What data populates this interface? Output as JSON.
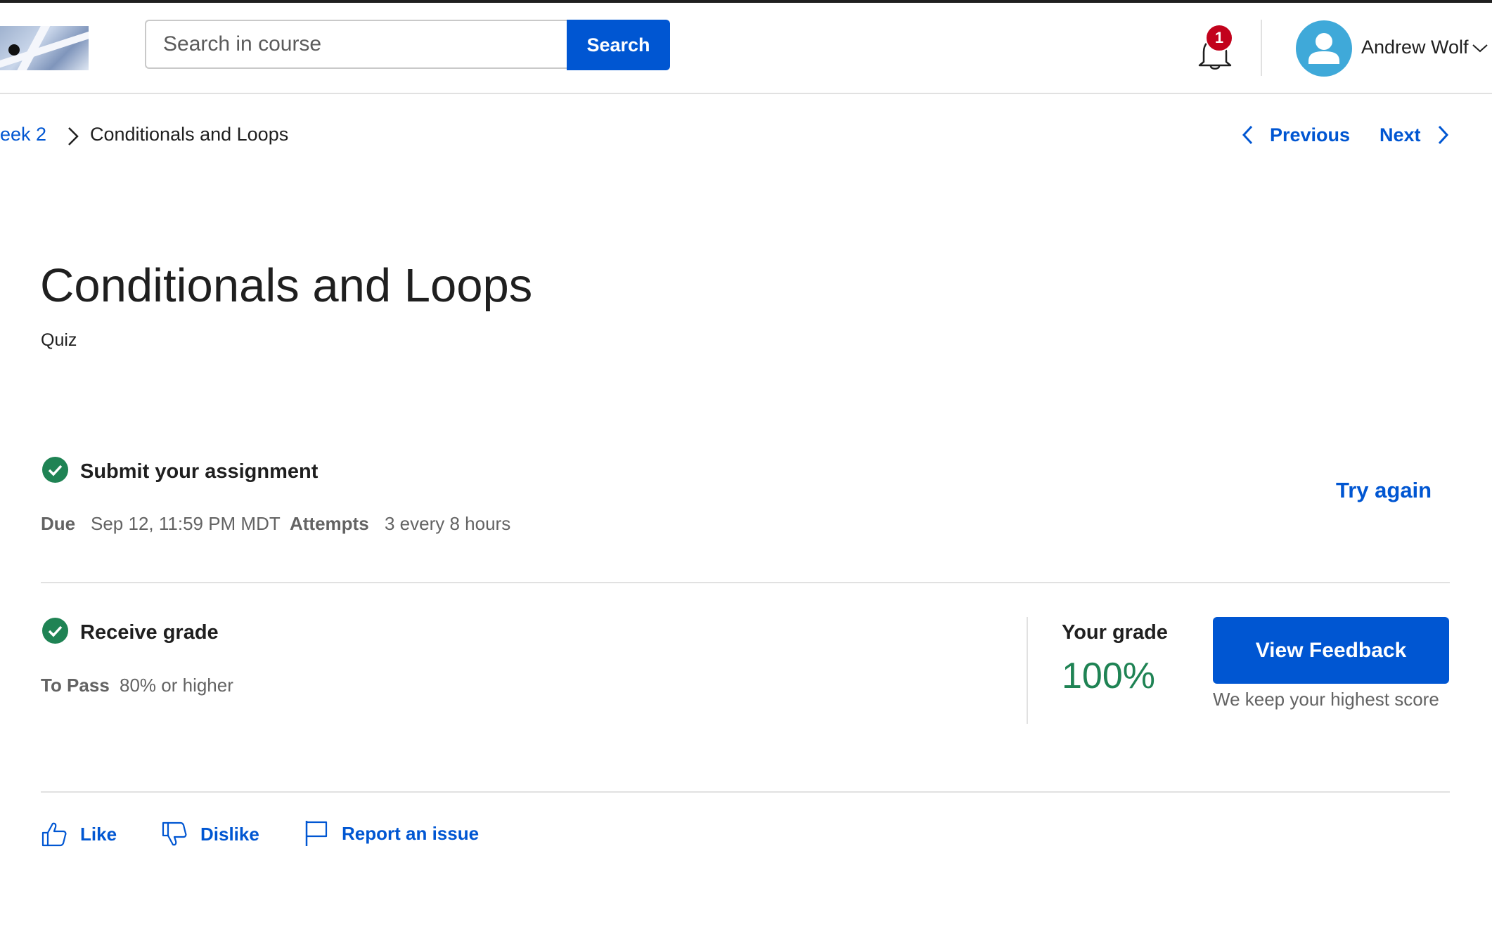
{
  "header": {
    "search_placeholder": "Search in course",
    "search_button": "Search",
    "notification_count": "1",
    "user_name": "Andrew Wolf"
  },
  "breadcrumb": {
    "parent": "eek 2",
    "current": "Conditionals and Loops"
  },
  "nav": {
    "previous": "Previous",
    "next": "Next"
  },
  "page": {
    "title": "Conditionals and Loops",
    "type": "Quiz"
  },
  "submit_section": {
    "title": "Submit your assignment",
    "due_label": "Due",
    "due_value": "Sep 12, 11:59 PM MDT",
    "attempts_label": "Attempts",
    "attempts_value": "3 every 8 hours",
    "try_again": "Try again"
  },
  "grade_section": {
    "title": "Receive grade",
    "to_pass_label": "To Pass",
    "to_pass_value": "80% or higher",
    "your_grade_label": "Your grade",
    "your_grade_value": "100%",
    "view_feedback": "View Feedback",
    "note": "We keep your highest score"
  },
  "footer_actions": {
    "like": "Like",
    "dislike": "Dislike",
    "report": "Report an issue"
  },
  "colors": {
    "brand_blue": "#0056d2",
    "success_green": "#1f8354",
    "badge_red": "#c2021c",
    "avatar_blue": "#3fa9d9"
  },
  "icons": [
    "logo-image",
    "bell-icon",
    "avatar-icon",
    "chevron-down-icon",
    "chevron-right-icon",
    "chevron-left-icon",
    "check-circle-icon",
    "thumbs-up-icon",
    "thumbs-down-icon",
    "flag-icon"
  ]
}
